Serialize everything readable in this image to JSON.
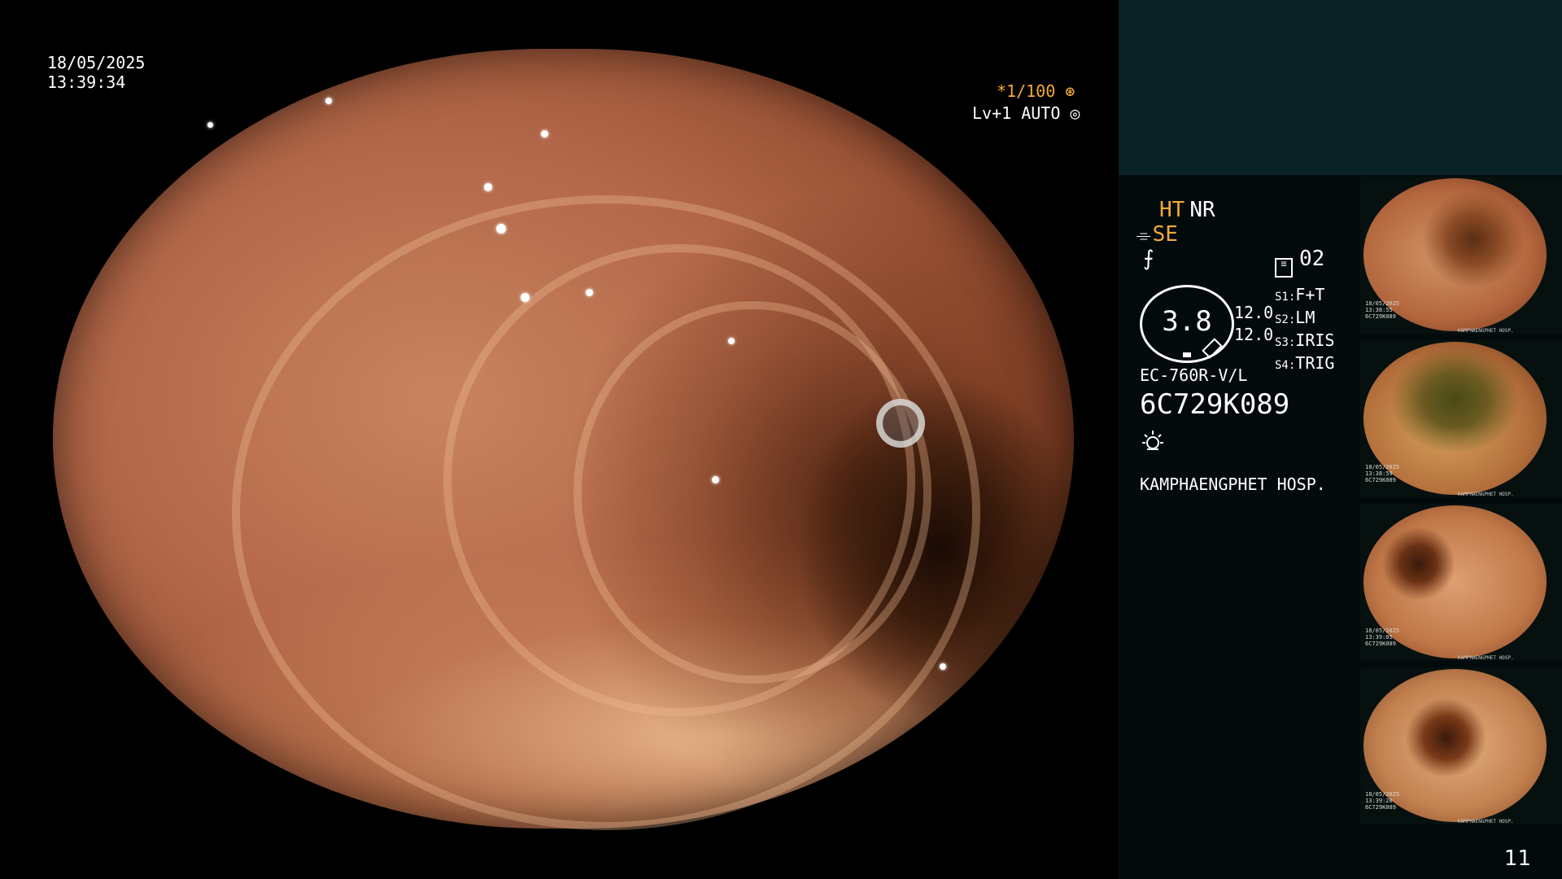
{
  "overlay": {
    "date": "18/05/2025",
    "time": "13:39:34",
    "shutter": "*1/100",
    "shutter_icon": "aperture-icon",
    "level": "Lv+1 AUTO",
    "level_icon": "target-icon"
  },
  "panel": {
    "ht": "HT",
    "nr": "NR",
    "se": "SE",
    "f_icon": "⨍",
    "mode_icon_label": "≡",
    "mode_value": "02",
    "oval_value": "3.8",
    "num1": "12.0",
    "num2": "12.0",
    "s_items": [
      {
        "key": "S1:",
        "value": "F+T"
      },
      {
        "key": "S2:",
        "value": "LM"
      },
      {
        "key": "S3:",
        "value": "IRIS"
      },
      {
        "key": "S4:",
        "value": "TRIG"
      }
    ],
    "model": "EC-760R-V/L",
    "serial": "6C729K089",
    "light_icon": "light-icon",
    "hospital": "KAMPHAENGPHET HOSP."
  },
  "thumbnails": [
    {
      "date": "18/05/2025",
      "time": "13:38:55",
      "serial": "6C729K089",
      "foot": "KAMPHAENGPHET HOSP."
    },
    {
      "date": "18/05/2025",
      "time": "13:38:59",
      "serial": "6C729K089",
      "foot": "KAMPHAENGPHET HOSP."
    },
    {
      "date": "18/05/2025",
      "time": "13:39:05",
      "serial": "6C729K089",
      "foot": "KAMPHAENGPHET HOSP."
    },
    {
      "date": "18/05/2025",
      "time": "13:39:20",
      "serial": "6C729K089",
      "foot": "KAMPHAENGPHET HOSP."
    }
  ],
  "page_number": "11",
  "colors": {
    "accent": "#f2a93b",
    "panel_top": "#0a2226",
    "panel_bg": "#020a0c"
  }
}
